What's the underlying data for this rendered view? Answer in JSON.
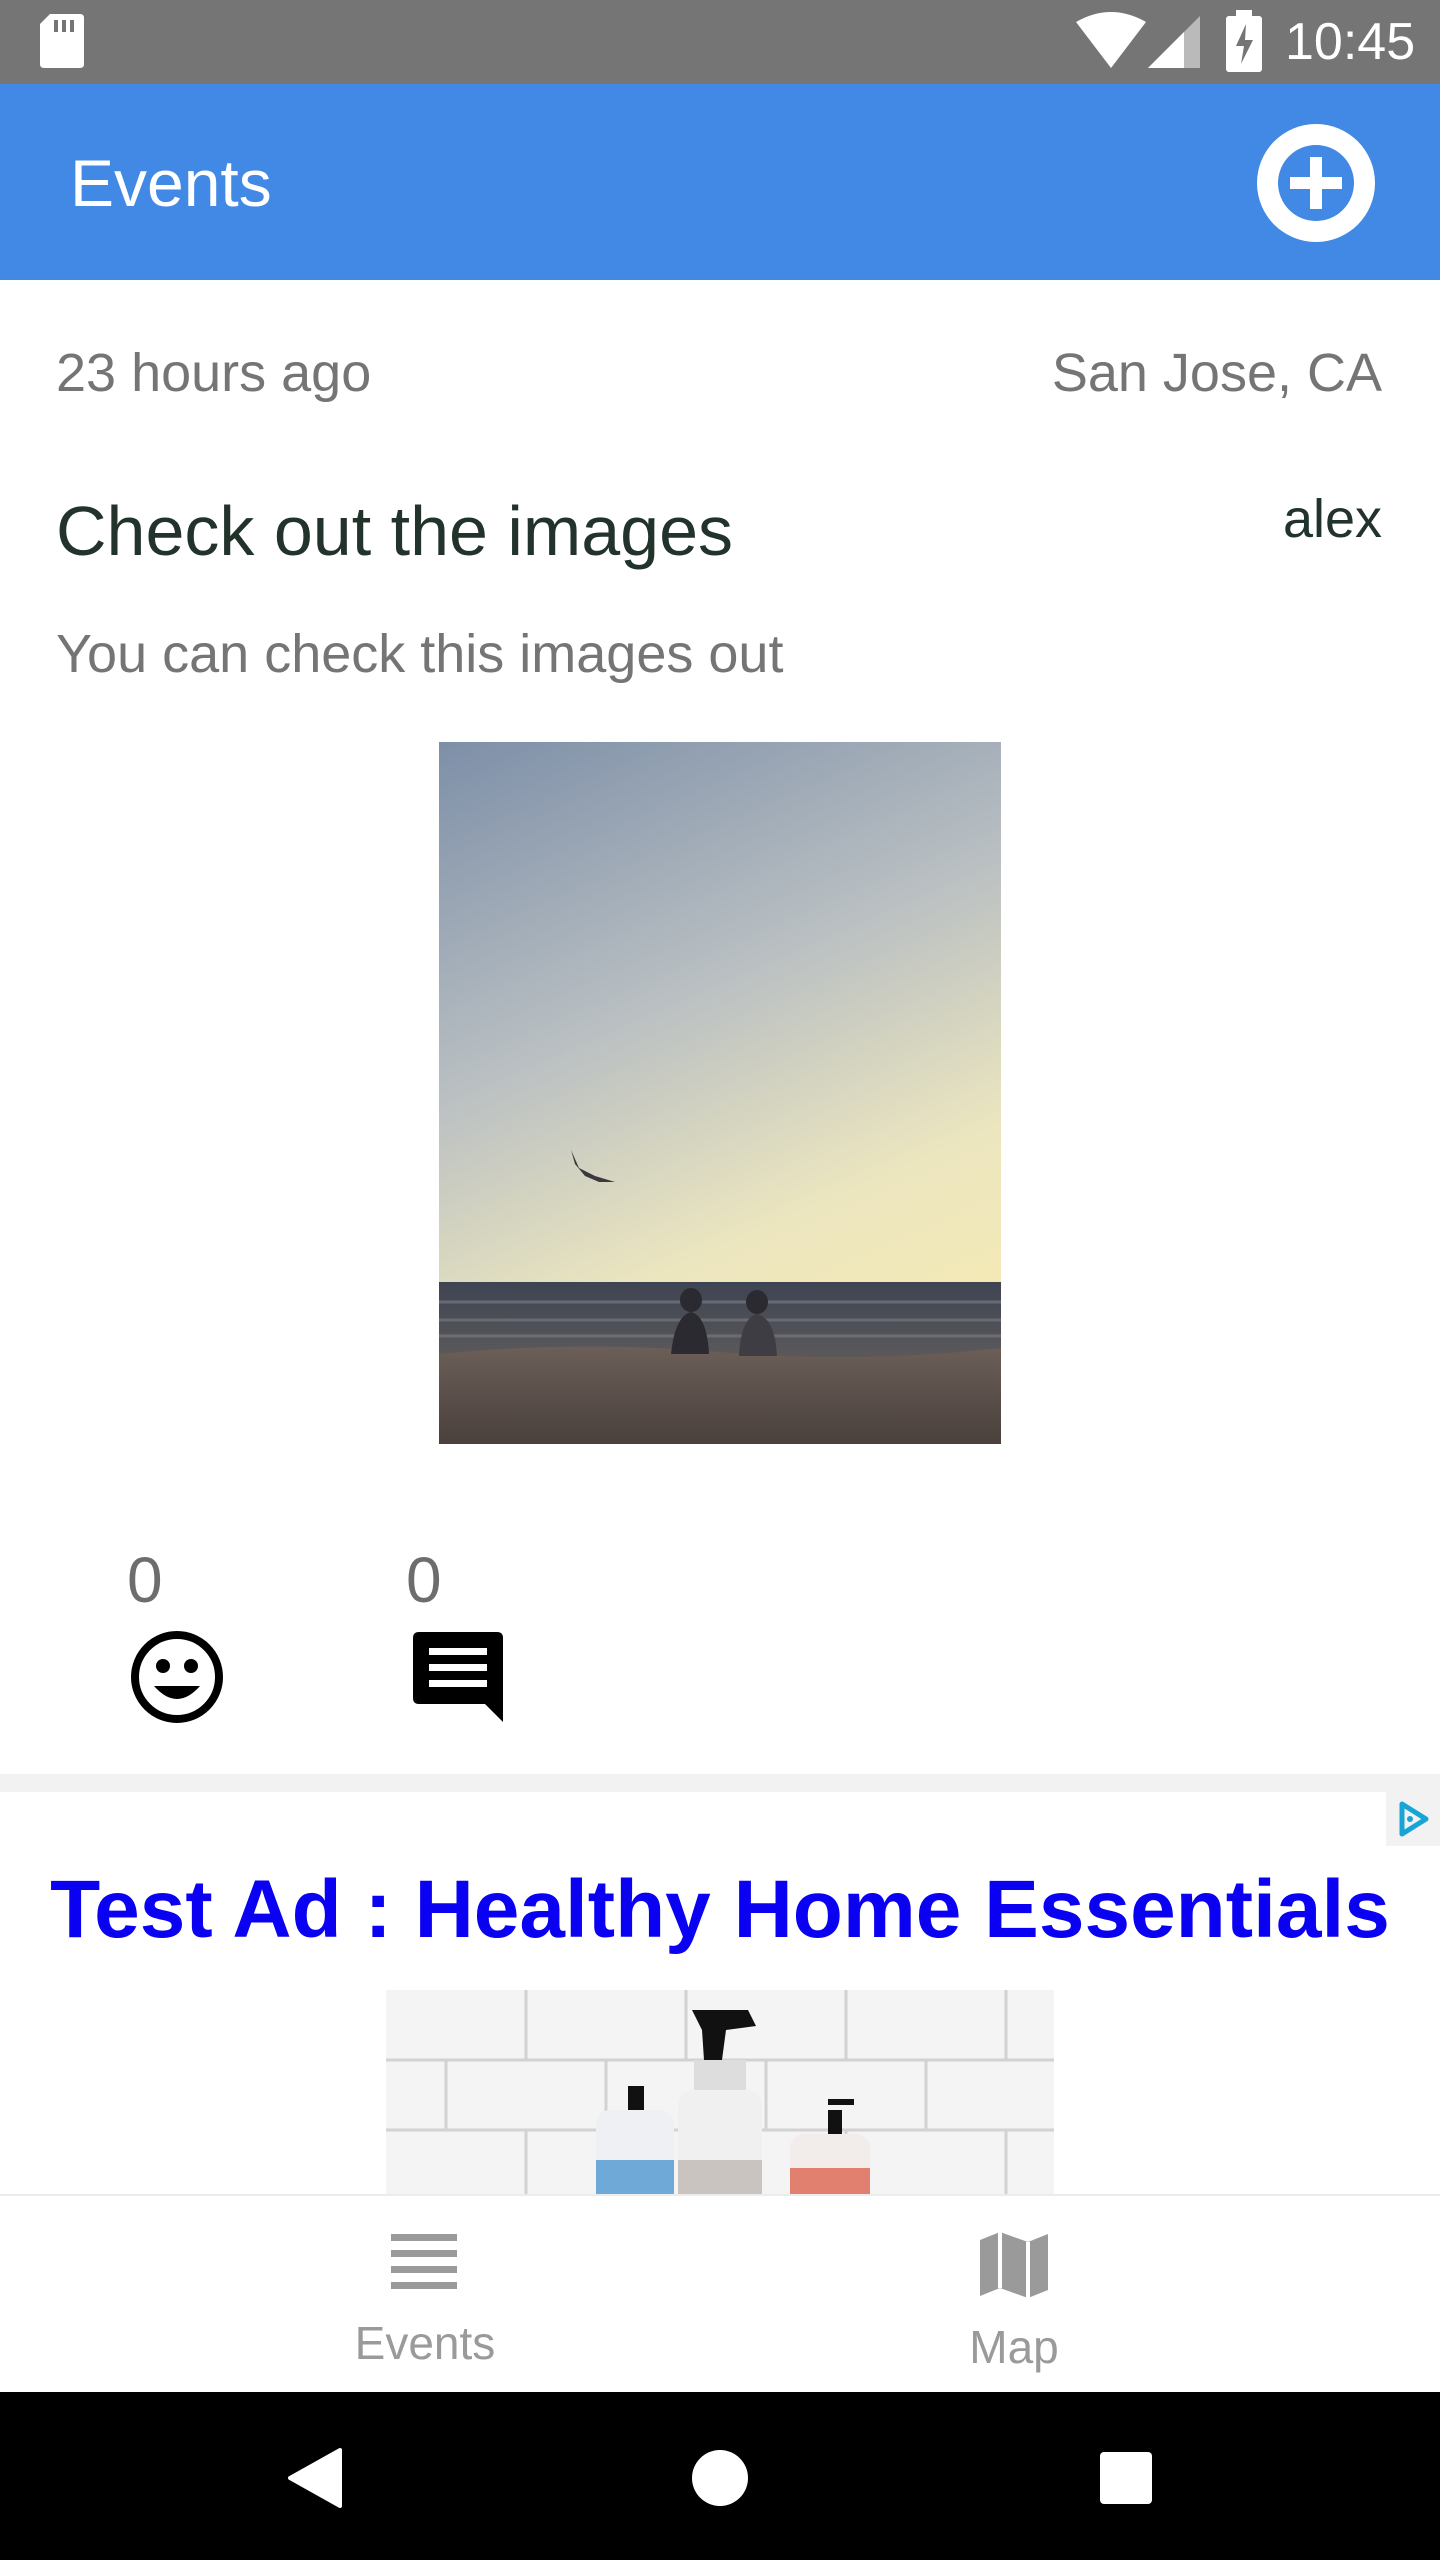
{
  "status_bar": {
    "time": "10:45",
    "icons": [
      "sd-card-icon",
      "wifi-icon",
      "signal-icon",
      "battery-charging-icon"
    ]
  },
  "app_bar": {
    "title": "Events",
    "add_icon": "plus-circle-icon"
  },
  "event": {
    "time_ago": "23 hours ago",
    "location": "San Jose, CA",
    "title": "Check out the images",
    "author": "alex",
    "description": "You can check this images out",
    "image_description": "beach at sunset with a seagull and two people sitting on sand",
    "reactions_count": "0",
    "comments_count": "0",
    "reaction_icon": "smiley-face-icon",
    "comment_icon": "comment-icon"
  },
  "ad": {
    "headline": "Test Ad : Healthy Home Essentials",
    "adchoices_icon": "adchoices-icon",
    "image_description": "cleaning product bottles on white tile"
  },
  "bottom_nav": {
    "items": [
      {
        "label": "Events",
        "icon": "list-icon"
      },
      {
        "label": "Map",
        "icon": "map-icon"
      }
    ]
  },
  "system_nav": {
    "buttons": [
      "back-icon",
      "home-icon",
      "recents-icon"
    ]
  },
  "colors": {
    "app_bar": "#4189e4",
    "status_bar": "#757575",
    "ad_headline": "#0a00f2",
    "secondary_text": "#757575",
    "primary_text": "#22332b"
  }
}
